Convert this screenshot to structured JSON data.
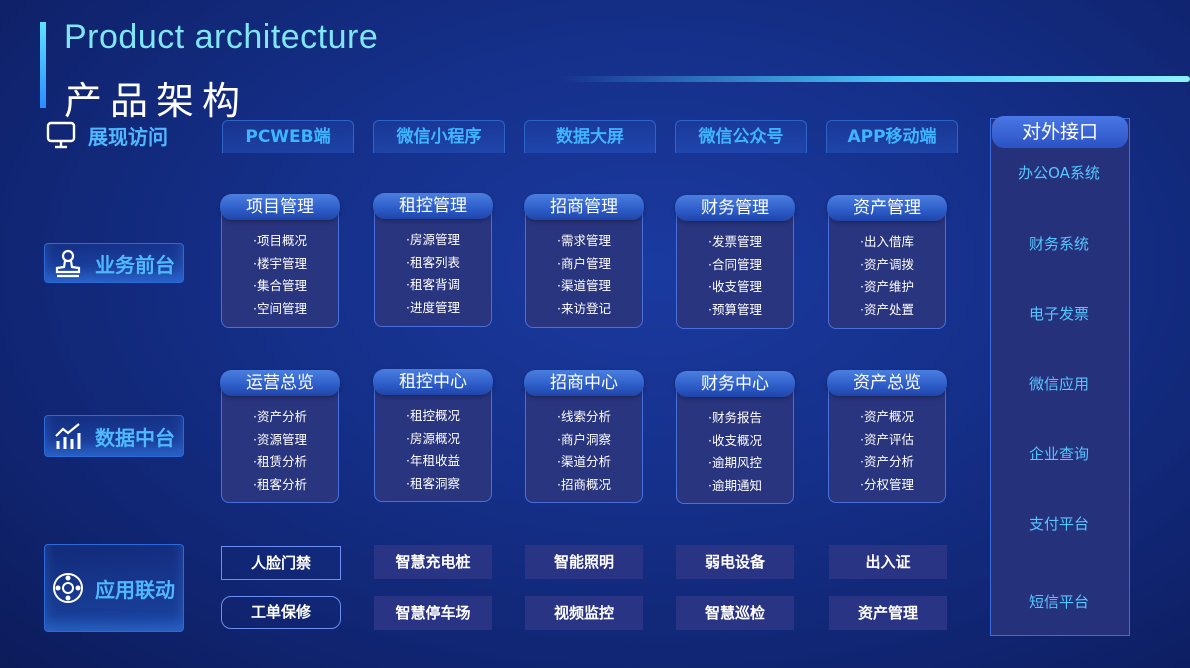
{
  "header": {
    "title_en": "Product architecture",
    "title_cn": "产品架构"
  },
  "rows": {
    "display": "展现访问",
    "business": "业务前台",
    "data": "数据中台",
    "apps": "应用联动"
  },
  "tabs": [
    "PCWEB端",
    "微信小程序",
    "数据大屏",
    "微信公众号",
    "APP移动端"
  ],
  "business_cards": [
    {
      "title": "项目管理",
      "items": [
        "·项目概况",
        "·楼宇管理",
        "·集合管理",
        "·空间管理"
      ]
    },
    {
      "title": "租控管理",
      "items": [
        "·房源管理",
        "·租客列表",
        "·租客背调",
        "·进度管理"
      ]
    },
    {
      "title": "招商管理",
      "items": [
        "·需求管理",
        "·商户管理",
        "·渠道管理",
        "·来访登记"
      ]
    },
    {
      "title": "财务管理",
      "items": [
        "·发票管理",
        "·合同管理",
        "·收支管理",
        "·预算管理"
      ]
    },
    {
      "title": "资产管理",
      "items": [
        "·出入借库",
        "·资产调拨",
        "·资产维护",
        "·资产处置"
      ]
    }
  ],
  "data_cards": [
    {
      "title": "运营总览",
      "items": [
        "·资产分析",
        "·资源管理",
        "·租赁分析",
        "·租客分析"
      ]
    },
    {
      "title": "租控中心",
      "items": [
        "·租控概况",
        "·房源概况",
        "·年租收益",
        "·租客洞察"
      ]
    },
    {
      "title": "招商中心",
      "items": [
        "·线索分析",
        "·商户洞察",
        "·渠道分析",
        "·招商概况"
      ]
    },
    {
      "title": "财务中心",
      "items": [
        "·财务报告",
        "·收支概况",
        "·逾期风控",
        "·逾期通知"
      ]
    },
    {
      "title": "资产总览",
      "items": [
        "·资产概况",
        "·资产评估",
        "·资产分析",
        "·分权管理"
      ]
    }
  ],
  "apps_row1": [
    "人脸门禁",
    "智慧充电桩",
    "智能照明",
    "弱电设备",
    "出入证"
  ],
  "apps_row2": [
    "工单保修",
    "智慧停车场",
    "视频监控",
    "智慧巡检",
    "资产管理"
  ],
  "side_panel": {
    "title": "对外接口",
    "items": [
      "办公OA系统",
      "财务系统",
      "电子发票",
      "微信应用",
      "企业查询",
      "支付平台",
      "短信平台"
    ]
  }
}
